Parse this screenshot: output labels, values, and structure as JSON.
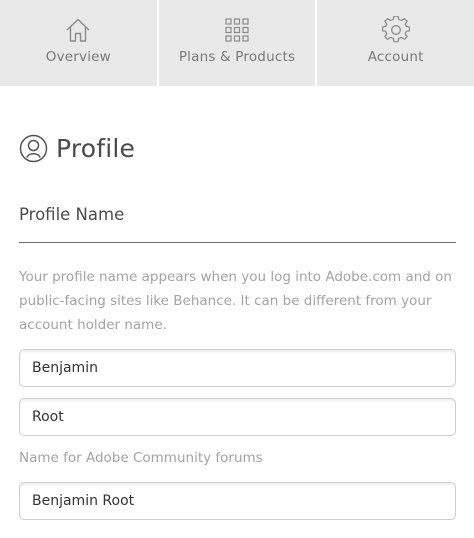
{
  "nav": {
    "items": [
      {
        "label": "Overview",
        "icon": "home-icon"
      },
      {
        "label": "Plans & Products",
        "icon": "grid-icon"
      },
      {
        "label": "Account",
        "icon": "gear-icon"
      }
    ]
  },
  "profile": {
    "title": "Profile",
    "icon": "user-circle-icon",
    "subhead": "Profile Name",
    "helper": "Your profile name appears when you log into Adobe.com and on public-facing sites like Behance. It can be different from your account holder name.",
    "first_name": "Benjamin",
    "last_name": "Root",
    "forum_label": "Name for Adobe Community forums",
    "forum_name": "Benjamin Root"
  },
  "colors": {
    "nav_background": "#e9e9e9",
    "nav_text": "#7a7a7a",
    "heading_text": "#4a4a4a",
    "helper_text": "#a3a3a3",
    "field_border": "#cfcfcf"
  }
}
